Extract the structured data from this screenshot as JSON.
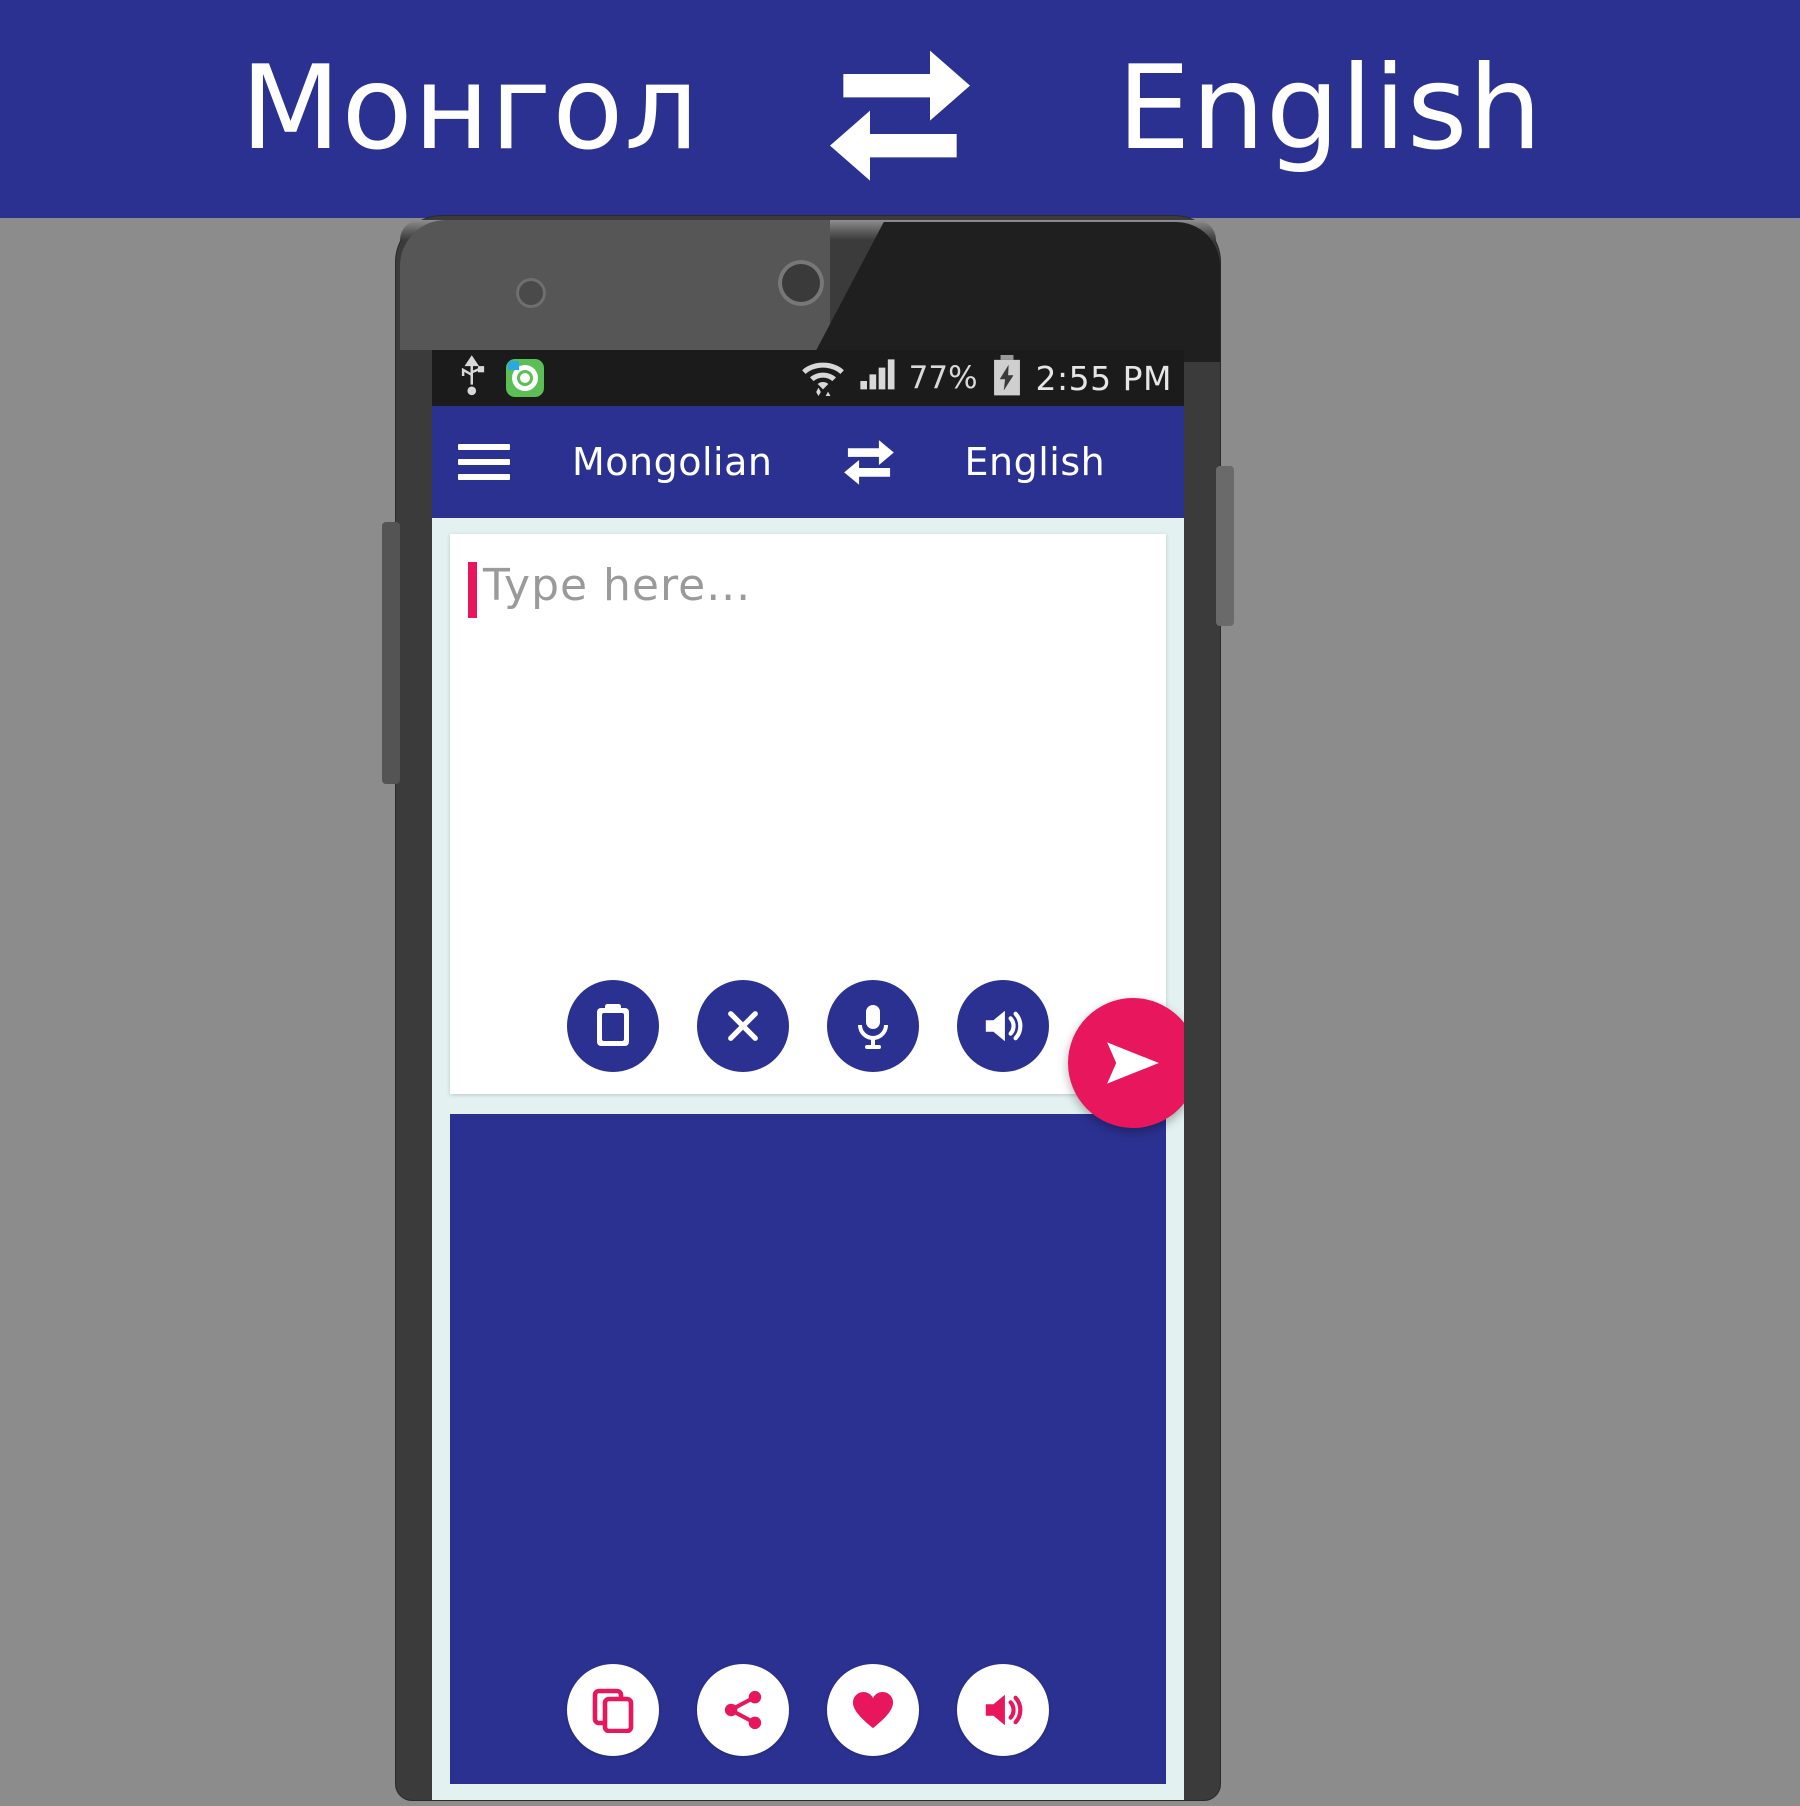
{
  "banner": {
    "source_language": "Монгол",
    "target_language": "English",
    "swap_icon": "swap-repeat-icon",
    "background_color": "#2B3190",
    "text_color": "#FFFFFF"
  },
  "page_background_color": "#8C8C8C",
  "phone": {
    "status_bar": {
      "background_color": "#1B1B1B",
      "left_icons": [
        "usb-icon",
        "app-notification-icon"
      ],
      "right_icons": [
        "wifi-icon",
        "signal-bars-icon",
        "battery-charging-icon"
      ],
      "battery_percent": "77%",
      "time": "2:55 PM"
    },
    "toolbar": {
      "background_color": "#2B3190",
      "menu_icon": "hamburger-menu-icon",
      "source_language": "Mongolian",
      "swap_icon": "swap-arrows-icon",
      "target_language": "English"
    },
    "input_card": {
      "background_color": "#FFFFFF",
      "placeholder": "Type here...",
      "value": "",
      "caret_color": "#E8175D",
      "actions": [
        {
          "name": "paste-button",
          "icon": "clipboard-icon",
          "style": "blue"
        },
        {
          "name": "clear-button",
          "icon": "close-x-icon",
          "style": "blue"
        },
        {
          "name": "speak-button",
          "icon": "microphone-icon",
          "style": "blue"
        },
        {
          "name": "listen-button",
          "icon": "speaker-icon",
          "style": "blue"
        }
      ]
    },
    "send_button": {
      "name": "translate-send-button",
      "icon": "send-paper-plane-icon",
      "color": "#E8175D"
    },
    "output_card": {
      "background_color": "#2B3190",
      "text": "",
      "actions": [
        {
          "name": "copy-button",
          "icon": "copy-icon",
          "style": "white"
        },
        {
          "name": "share-button",
          "icon": "share-icon",
          "style": "white"
        },
        {
          "name": "favorite-button",
          "icon": "heart-icon",
          "style": "white"
        },
        {
          "name": "speak-out-button",
          "icon": "speaker-icon",
          "style": "white"
        }
      ]
    }
  }
}
